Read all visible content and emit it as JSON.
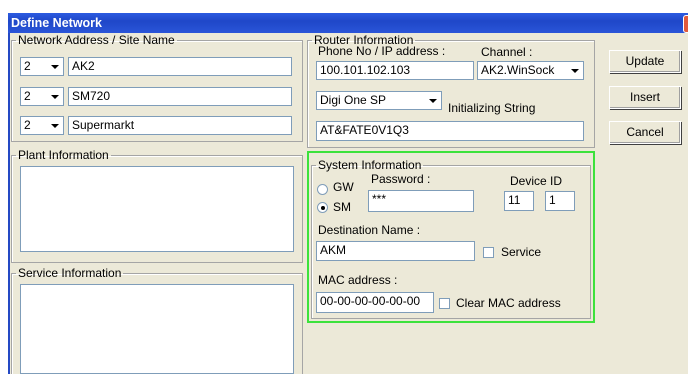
{
  "window": {
    "title": "Define Network",
    "close_glyph": "✕"
  },
  "network_address": {
    "legend": "Network Address / Site Name",
    "rows": [
      {
        "number": "2",
        "name": "AK2"
      },
      {
        "number": "2",
        "name": "SM720"
      },
      {
        "number": "2",
        "name": "Supermarkt"
      }
    ]
  },
  "router": {
    "legend": "Router Information",
    "phone_label": "Phone No / IP address :",
    "channel_label": "Channel :",
    "phone_value": "100.101.102.103",
    "channel_value": "AK2.WinSock",
    "modem_value": "Digi One SP",
    "init_label": "Initializing String",
    "init_value": "AT&FATE0V1Q3"
  },
  "plant": {
    "legend": "Plant Information"
  },
  "service_info": {
    "legend": "Service Information"
  },
  "system": {
    "legend": "System Information",
    "gw_label": "GW",
    "sm_label": "SM",
    "password_label": "Password :",
    "password_value": "***",
    "device_id_label": "Device ID",
    "device_id_1": "11",
    "device_id_2": "1",
    "destination_label": "Destination Name :",
    "destination_value": "AKM",
    "service_label": "Service",
    "mac_label": "MAC address :",
    "mac_value": "00-00-00-00-00-00",
    "clear_mac_label": "Clear MAC address"
  },
  "buttons": {
    "update": "Update",
    "insert": "Insert",
    "cancel": "Cancel"
  },
  "colors": {
    "titlebar": "#2c5be0",
    "face": "#ece9d8",
    "highlight": "#3ce23c"
  }
}
